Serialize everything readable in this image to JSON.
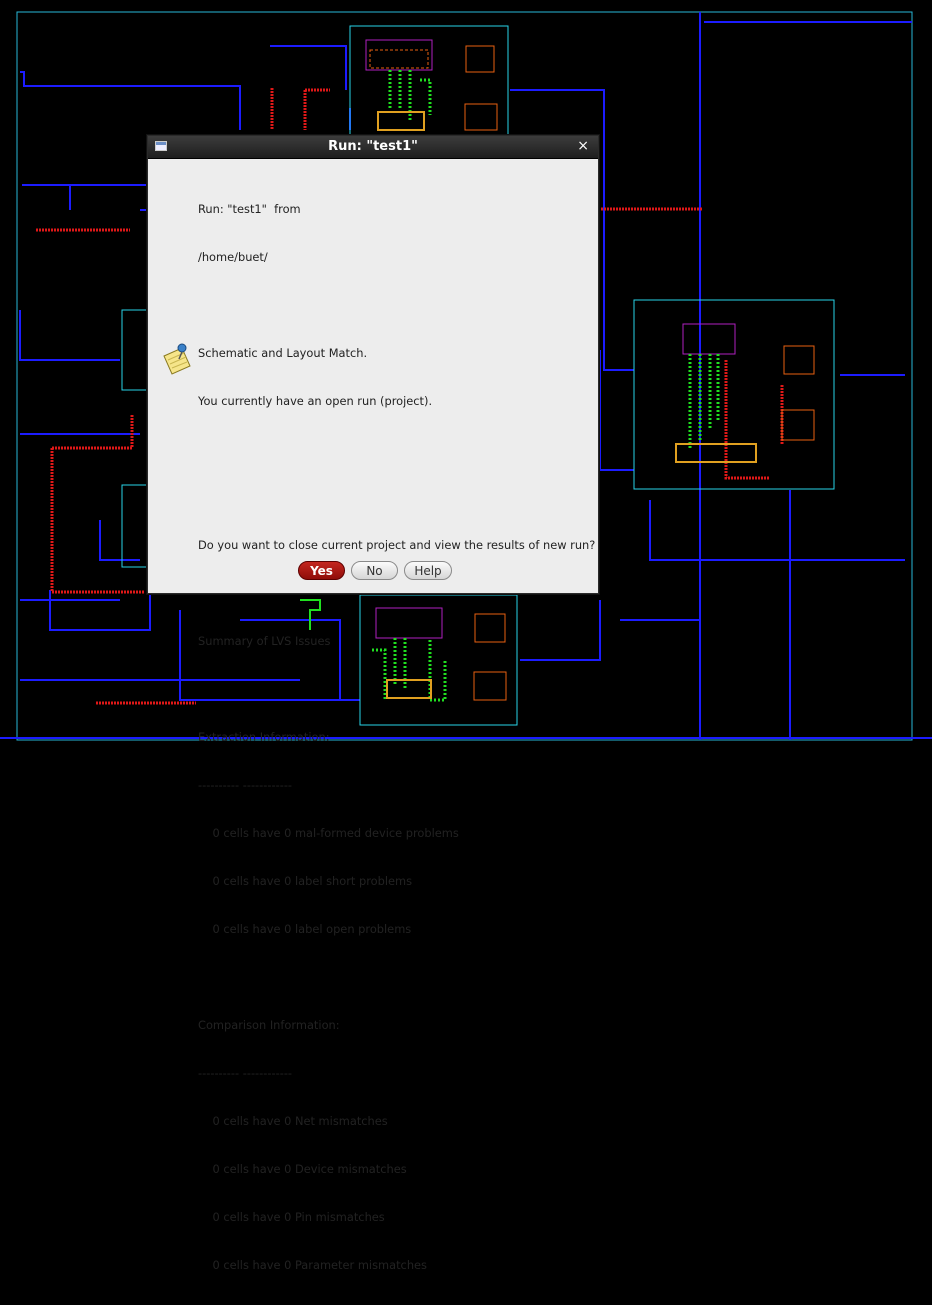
{
  "dialog": {
    "title": "Run: \"test1\"",
    "lines": [
      "Run: \"test1\"  from",
      "/home/buet/",
      "",
      "Schematic and Layout Match.",
      "You currently have an open run (project).",
      "",
      "",
      "Do you want to close current project and view the results of new run?",
      "",
      "Summary of LVS Issues",
      "",
      "Extraction Information:",
      "---------- ------------",
      "    0 cells have 0 mal-formed device problems",
      "    0 cells have 0 label short problems",
      "    0 cells have 0 label open problems",
      "",
      "Comparison Information:",
      "---------- ------------",
      "    0 cells have 0 Net mismatches",
      "    0 cells have 0 Device mismatches",
      "    0 cells have 0 Pin mismatches",
      "    0 cells have 0 Parameter mismatches"
    ],
    "buttons": {
      "yes": "Yes",
      "no": "No",
      "help": "Help"
    },
    "close_glyph": "×",
    "icons": {
      "app": "window-icon",
      "message": "note-pin-icon"
    }
  },
  "colors": {
    "background": "#000000",
    "metal1": "#1a1aff",
    "poly": "#e02020",
    "cell_boundary": "#29d3e8",
    "active": "#20e020",
    "contact": "#d7a020",
    "primary_button": "#b3170f"
  }
}
